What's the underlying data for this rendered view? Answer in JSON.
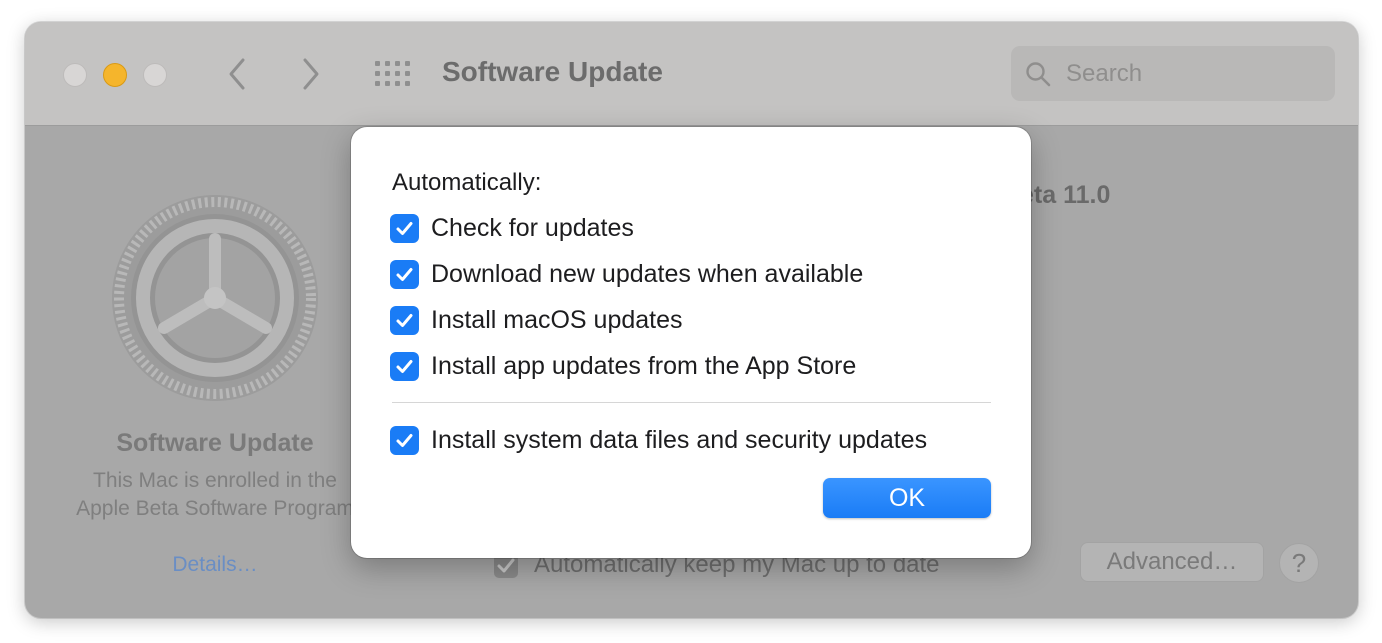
{
  "window": {
    "title": "Software Update",
    "search": {
      "placeholder": "Search"
    }
  },
  "pane": {
    "title": "Software Update",
    "description": "This Mac is enrolled in the Apple Beta Software Program",
    "link": "Details…",
    "version_fragment": "eta 11.0",
    "auto_update_label": "Automatically keep my Mac up to date",
    "advanced_label": "Advanced…",
    "help_label": "?"
  },
  "sheet": {
    "heading": "Automatically:",
    "options": [
      {
        "label": "Check for updates",
        "checked": true
      },
      {
        "label": "Download new updates when available",
        "checked": true
      },
      {
        "label": "Install macOS updates",
        "checked": true
      },
      {
        "label": "Install app updates from the App Store",
        "checked": true
      },
      {
        "label": "Install system data files and security updates",
        "checked": true
      }
    ],
    "ok_label": "OK"
  },
  "colors": {
    "accent": "#1a7cf6",
    "minimize": "#f5b52c",
    "dimmed_background": "#a8a8a8"
  },
  "icons": [
    "chevron-left-icon",
    "chevron-right-icon",
    "grid-icon",
    "search-icon",
    "gear-icon",
    "checkmark-icon",
    "help-icon"
  ]
}
